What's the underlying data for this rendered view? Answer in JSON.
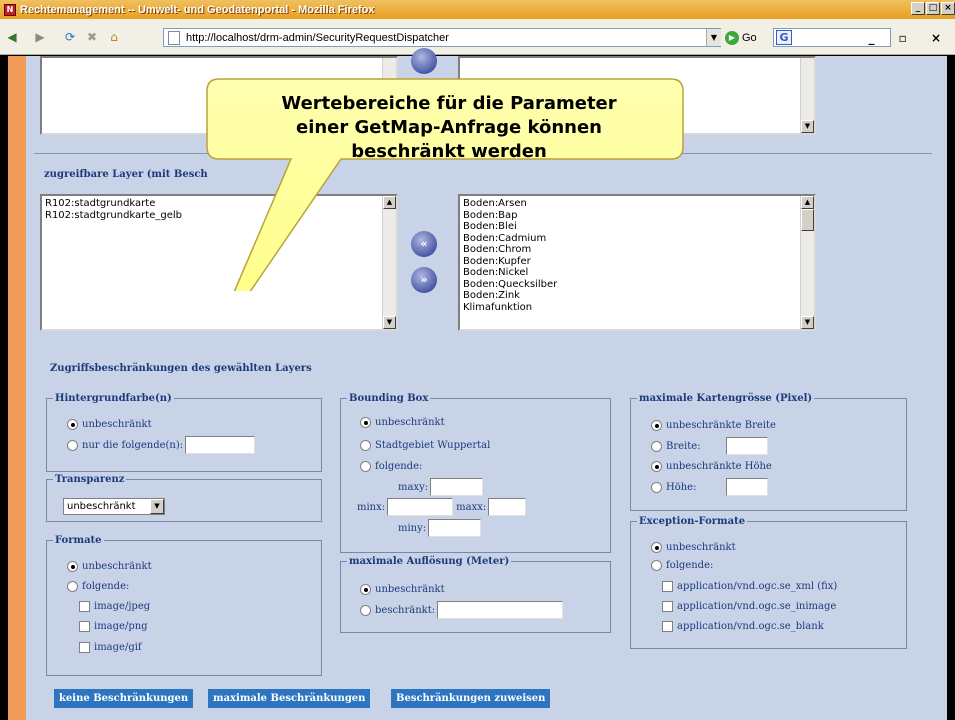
{
  "window": {
    "title": "Rechtemanagement -- Umwelt- und Geodatenportal - Mozilla Firefox",
    "url": "http://localhost/drm-admin/SecurityRequestDispatcher",
    "go_label": "Go"
  },
  "layer_section": {
    "heading": "zugreifbare Layer (mit Besch",
    "selected_layers": [
      "R102:stadtgrundkarte",
      "R102:stadtgrundkarte_gelb"
    ],
    "available_layers": [
      "Boden:Arsen",
      "Boden:Bap",
      "Boden:Blei",
      "Boden:Cadmium",
      "Boden:Chrom",
      "Boden:Kupfer",
      "Boden:Nickel",
      "Boden:Quecksilber",
      "Boden:Zink",
      "Klimafunktion"
    ]
  },
  "restrictions_heading": "Zugriffsbeschränkungen des gewählten Layers",
  "background": {
    "legend": "Hintergrundfarbe(n)",
    "opt_unrestricted": "unbeschränkt",
    "opt_following": "nur die folgende(n):"
  },
  "transparency": {
    "legend": "Transparenz",
    "selected": "unbeschränkt"
  },
  "formats": {
    "legend": "Formate",
    "opt_unrestricted": "unbeschränkt",
    "opt_following": "folgende:",
    "items": [
      "image/jpeg",
      "image/png",
      "image/gif"
    ]
  },
  "bbox": {
    "legend": "Bounding Box",
    "opt_unrestricted": "unbeschränkt",
    "opt_city": "Stadtgebiet Wuppertal",
    "opt_following": "folgende:",
    "maxy": "maxy:",
    "minx": "minx:",
    "maxx": "maxx:",
    "miny": "miny:"
  },
  "resolution": {
    "legend": "maximale Auflösung (Meter)",
    "opt_unrestricted": "unbeschränkt",
    "opt_restricted": "beschränkt:"
  },
  "mapsize": {
    "legend": "maximale Kartengrösse (Pixel)",
    "opt_width_unrestricted": "unbeschränkte Breite",
    "width": "Breite:",
    "opt_height_unrestricted": "unbeschränkte Höhe",
    "height": "Höhe:"
  },
  "exceptions": {
    "legend": "Exception-Formate",
    "opt_unrestricted": "unbeschränkt",
    "opt_following": "folgende:",
    "items": [
      "application/vnd.ogc.se_xml (fix)",
      "application/vnd.ogc.se_inimage",
      "application/vnd.ogc.se_blank"
    ]
  },
  "buttons": {
    "none": "keine Beschränkungen",
    "max": "maximale Beschränkungen",
    "assign": "Beschränkungen zuweisen"
  },
  "callout": {
    "line1": "Wertebereiche für die Parameter",
    "line2": "einer GetMap-Anfrage können",
    "line3": "beschränkt werden"
  },
  "colors": {
    "page_bg": "#c8d3e8",
    "left_bar": "#f29a57",
    "label_blue": "#1c3a7a",
    "button_blue": "#2e75c0",
    "callout_fill": "#ffff99"
  }
}
